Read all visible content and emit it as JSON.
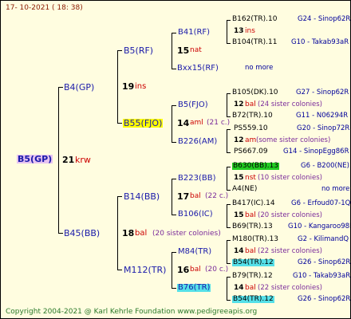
{
  "header": {
    "date_text": "17- 10-2021 ( 18: 38)"
  },
  "footer": {
    "copyright": "Copyright 2004-2021 @ Karl Kehrle Foundation  www.pedigreeapis.org"
  },
  "root": {
    "name": "B5(GP)",
    "num": "21",
    "suffix": "krw"
  },
  "gen1": {
    "top": {
      "name": "B4(GP)",
      "num": "19",
      "suffix": "ins"
    },
    "bottom": {
      "name": "B45(BB)",
      "num": "18",
      "suffix": "bal",
      "note": "(20 sister colonies)"
    }
  },
  "gen2": {
    "b5rf": {
      "name": "B5(RF)",
      "num": "15",
      "suffix": "nat"
    },
    "b55": {
      "name": "B55(FJO)",
      "num": "14",
      "suffix": "aml",
      "note": "(21 c.)"
    },
    "b14": {
      "name": "B14(BB)",
      "num": "17",
      "suffix": "bal",
      "note": "(22 c.)"
    },
    "m112": {
      "name": "M112(TR)",
      "num": "16",
      "suffix": "bal",
      "note": "(20 c.)"
    }
  },
  "gen3": {
    "b41": {
      "name": "B41(RF)"
    },
    "bxx15": {
      "name": "Bxx15(RF)"
    },
    "b5fjo": {
      "name": "B5(FJO)"
    },
    "b226": {
      "name": "B226(AM)"
    },
    "b223": {
      "name": "B223(BB)"
    },
    "b106": {
      "name": "B106(IC)"
    },
    "m84": {
      "name": "M84(TR)"
    },
    "b76": {
      "name": "B76(TR)"
    }
  },
  "gen4": [
    {
      "name": "B162(TR).10",
      "code": "G24 - Sinop62R"
    },
    {
      "num": "13",
      "suffix": "ins"
    },
    {
      "name": "B104(TR).11",
      "code": "G10 - Takab93aR"
    },
    {
      "code": "no more"
    },
    {
      "name": "B105(DK).10",
      "code": "G27 - Sinop62R"
    },
    {
      "num": "12",
      "suffix": "bal",
      "note": "(24 sister colonies)"
    },
    {
      "name": "B72(TR).10",
      "code": "G11 - N06294R"
    },
    {
      "name": "PS559.10",
      "code": "G20 - Sinop72R"
    },
    {
      "num": "12",
      "suffix": "am",
      "note": "(some sister colonies)"
    },
    {
      "name": "PS667.09",
      "code": "G14 - SinopEgg86R"
    },
    {
      "name": "B630(BB).13",
      "code": "G6 - B200(NE)"
    },
    {
      "num": "15",
      "suffix": "nst",
      "note": "(10 sister colonies)"
    },
    {
      "name": "A4(NE)",
      "code": "no more"
    },
    {
      "name": "B417(IC).14",
      "code": "G6 - Erfoud07-1Q"
    },
    {
      "num": "15",
      "suffix": "bal",
      "note": "(20 sister colonies)"
    },
    {
      "name": "B69(TR).13",
      "code": "G10 - Kangaroo98R"
    },
    {
      "name": "M180(TR).13",
      "code": "G2 - KilimandQ"
    },
    {
      "num": "14",
      "suffix": "bal",
      "note": "(22 sister colonies)"
    },
    {
      "name": "B54(TR).12",
      "code": "G26 - Sinop62R"
    },
    {
      "name": "B79(TR).12",
      "code": "G10 - Takab93aR"
    },
    {
      "num": "14",
      "suffix": "bal",
      "note": "(22 sister colonies)"
    },
    {
      "name": "B54(TR).12",
      "code": "G26 - Sinop62R"
    }
  ]
}
